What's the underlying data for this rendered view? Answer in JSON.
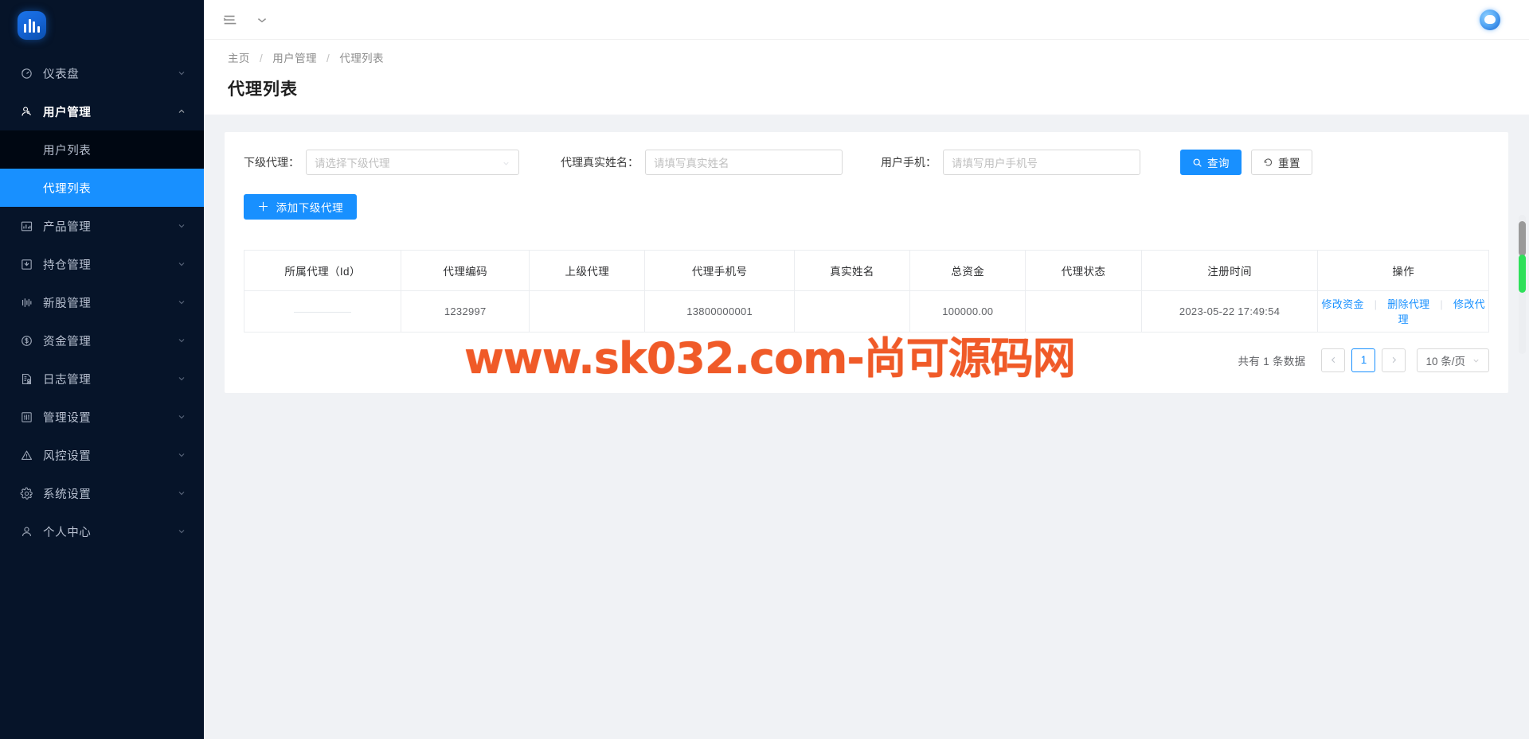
{
  "brand": {
    "logo_icon": "app-logo-bars",
    "accent": "#1890ff",
    "sidebar_bg": "#061429"
  },
  "topbar": {
    "menu_collapse_icon": "list-collapse-icon",
    "chevron_icon": "chevron-down-icon",
    "username": "",
    "avatar_icon": "user-avatar-icon"
  },
  "sidebar": {
    "items": [
      {
        "label": "仪表盘",
        "icon": "dashboard-icon",
        "arrow": "chevron-down-icon",
        "open": false
      },
      {
        "label": "用户管理",
        "icon": "user-manage-icon",
        "arrow": "chevron-up-icon",
        "open": true
      },
      {
        "label": "产品管理",
        "icon": "product-chart-icon",
        "arrow": "chevron-down-icon",
        "open": false
      },
      {
        "label": "持仓管理",
        "icon": "position-box-icon",
        "arrow": "chevron-down-icon",
        "open": false
      },
      {
        "label": "新股管理",
        "icon": "new-stock-icon",
        "arrow": "chevron-down-icon",
        "open": false
      },
      {
        "label": "资金管理",
        "icon": "money-circle-icon",
        "arrow": "chevron-down-icon",
        "open": false
      },
      {
        "label": "日志管理",
        "icon": "log-file-icon",
        "arrow": "chevron-down-icon",
        "open": false
      },
      {
        "label": "管理设置",
        "icon": "settings-sliders-icon",
        "arrow": "chevron-down-icon",
        "open": false
      },
      {
        "label": "风控设置",
        "icon": "warning-triangle-icon",
        "arrow": "chevron-down-icon",
        "open": false
      },
      {
        "label": "系统设置",
        "icon": "gear-icon",
        "arrow": "chevron-down-icon",
        "open": false
      },
      {
        "label": "个人中心",
        "icon": "person-icon",
        "arrow": "chevron-down-icon",
        "open": false
      }
    ],
    "submenu": [
      {
        "label": "用户列表",
        "active": false
      },
      {
        "label": "代理列表",
        "active": true
      }
    ]
  },
  "breadcrumb": {
    "items": [
      "主页",
      "用户管理",
      "代理列表"
    ],
    "separator": "/"
  },
  "page_title": "代理列表",
  "filters": {
    "agent": {
      "label": "下级代理：",
      "placeholder": "请选择下级代理",
      "value": "",
      "caret_icon": "chevron-down-icon"
    },
    "realname": {
      "label": "代理真实姓名：",
      "placeholder": "请填写真实姓名",
      "value": ""
    },
    "phone": {
      "label": "用户手机：",
      "placeholder": "请填写用户手机号",
      "value": ""
    },
    "search_button": {
      "label": "查询",
      "icon": "search-icon"
    },
    "reset_button": {
      "label": "重置",
      "icon": "reset-icon"
    }
  },
  "add_button": {
    "label": "添加下级代理",
    "icon": "plus-icon"
  },
  "table": {
    "columns": [
      "所属代理（Id）",
      "代理编码",
      "上级代理",
      "代理手机号",
      "真实姓名",
      "总资金",
      "代理状态",
      "注册时间",
      "操作"
    ],
    "rows": [
      {
        "owner_agent": "",
        "agent_code": "1232997",
        "parent_agent": "",
        "agent_phone": "13800000001",
        "real_name": "",
        "total_funds": "100000.00",
        "agent_status": "",
        "register_time": "2023-05-22 17:49:54",
        "actions": [
          "修改资金",
          "删除代理",
          "修改代理"
        ]
      }
    ]
  },
  "pagination": {
    "total_text": "共有 1 条数据",
    "prev_icon": "chevron-left-icon",
    "next_icon": "chevron-right-icon",
    "pages": [
      "1"
    ],
    "current_page": "1",
    "page_size": "10 条/页",
    "page_size_caret": "chevron-down-icon"
  },
  "watermark": {
    "text": "www.sk032.com-尚可源码网",
    "color": "#f05a28"
  },
  "scrollbar": {
    "name": "vertical-scrollbar",
    "thumb_color": "#2ee05a"
  }
}
